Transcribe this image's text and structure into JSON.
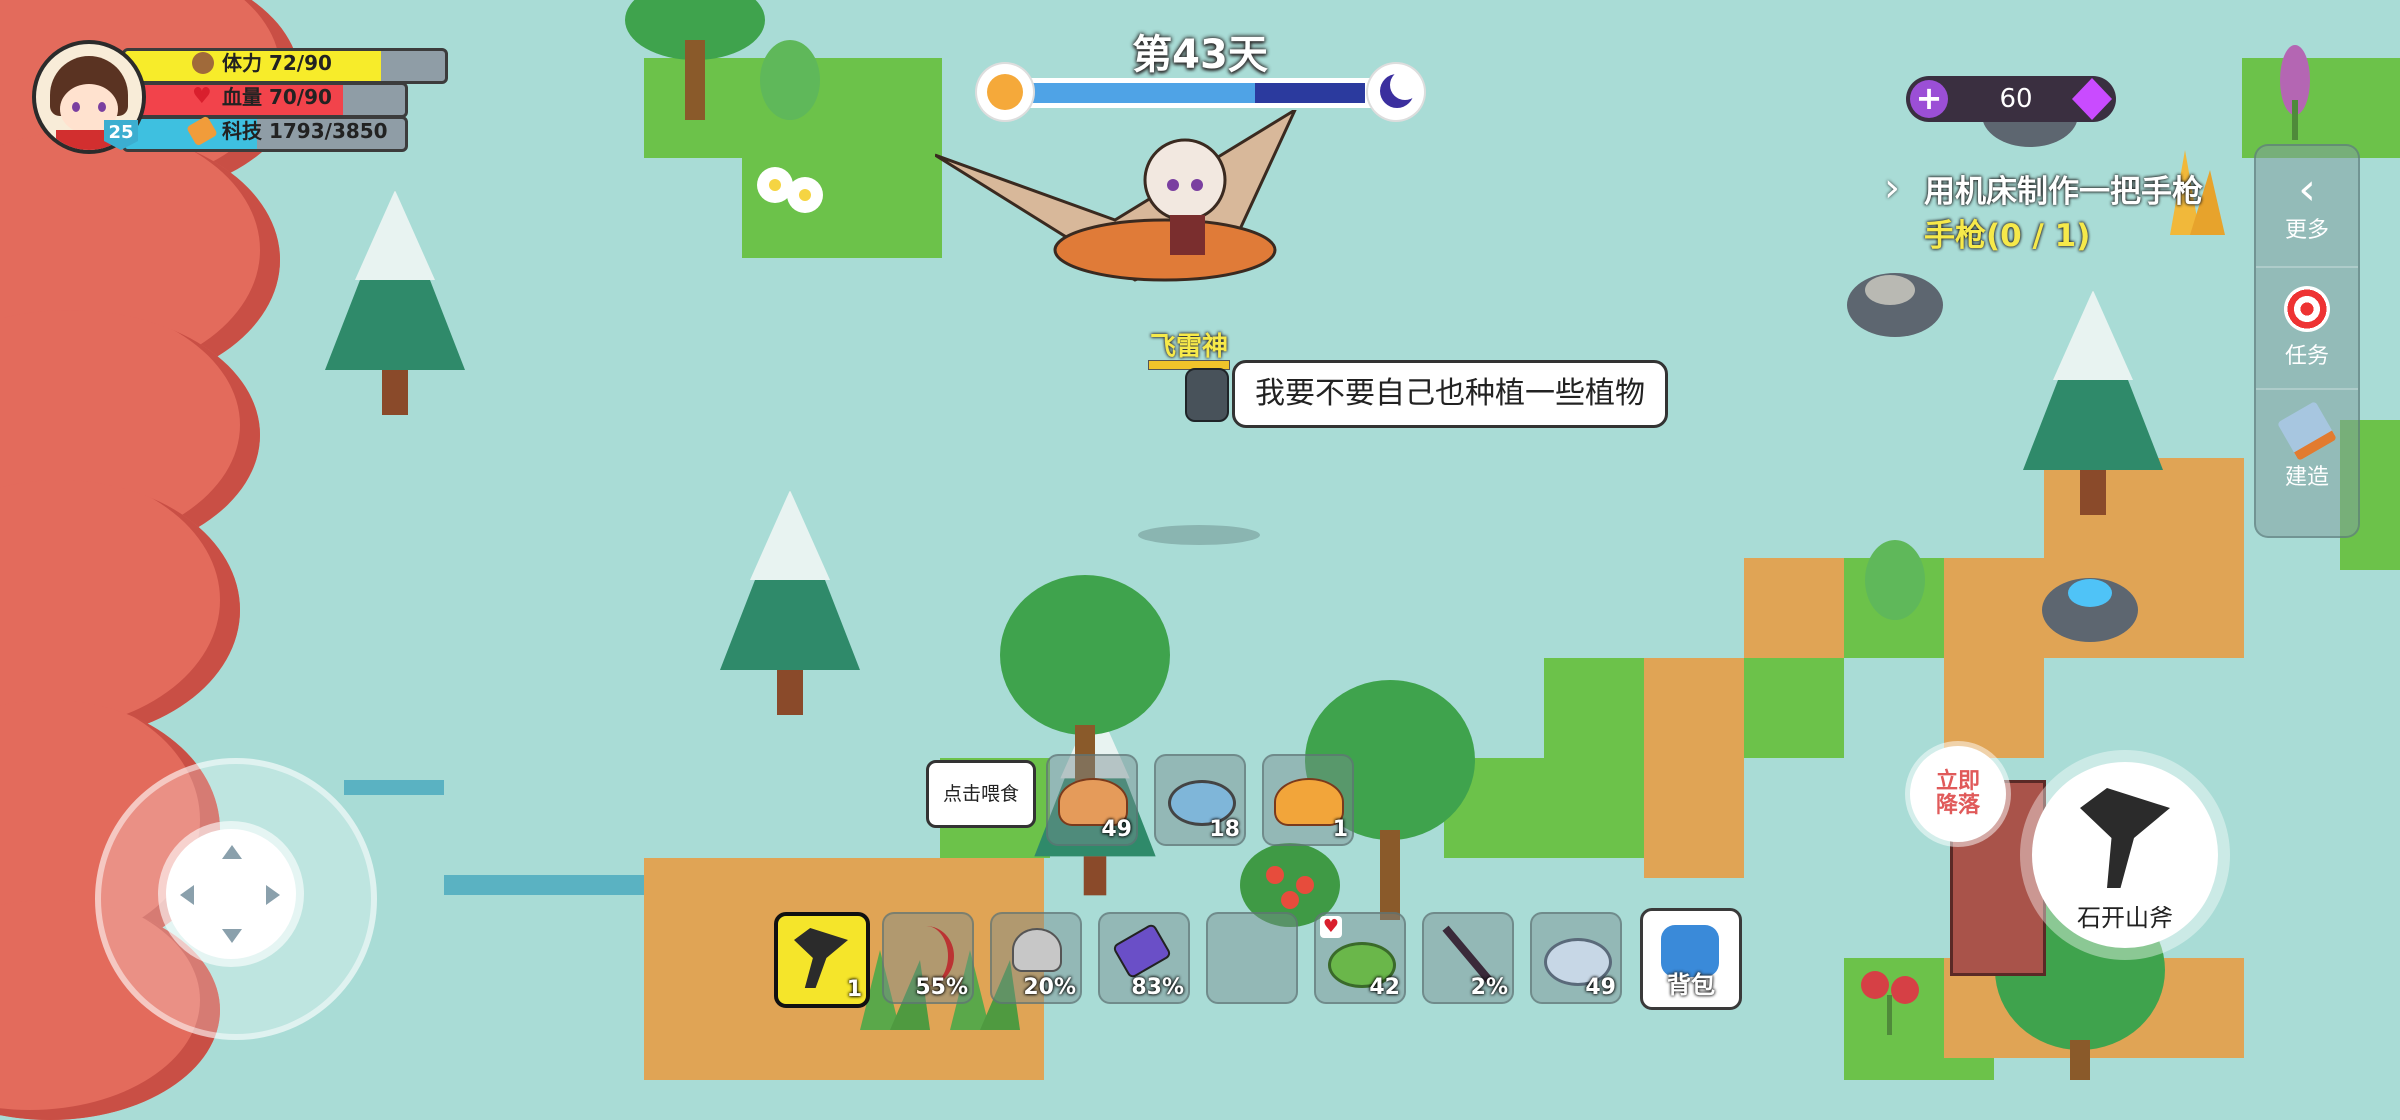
{
  "hud": {
    "level": "25",
    "stamina": {
      "label": "体力",
      "value": "72/90",
      "fraction": 0.8
    },
    "health": {
      "label": "血量",
      "value": "70/90",
      "fraction": 0.78
    },
    "tech": {
      "label": "科技",
      "value": "1793/3850",
      "fraction": 0.47
    }
  },
  "day": {
    "label": "第43天",
    "progress": 0.68
  },
  "gems": {
    "value": "60"
  },
  "quest": {
    "title": "用机床制作一把手枪",
    "progress": "手枪(0 / 1)"
  },
  "sidebar": [
    {
      "label": "更多",
      "icon": "chevron-left-icon"
    },
    {
      "label": "任务",
      "icon": "target-icon"
    },
    {
      "label": "建造",
      "icon": "hammer-icon"
    }
  ],
  "npc": {
    "name": "飞雷神",
    "speech": "我要不要自己也种植一些植物"
  },
  "feed": {
    "label": "点击喂食",
    "items": [
      {
        "icon": "roast-meat-icon",
        "count": "49"
      },
      {
        "icon": "canned-food-icon",
        "count": "18"
      },
      {
        "icon": "fruit-tart-icon",
        "count": "1"
      }
    ]
  },
  "hotbar": [
    {
      "icon": "stone-axe-icon",
      "count": "1",
      "selected": true
    },
    {
      "icon": "bow-icon",
      "count": "55%"
    },
    {
      "icon": "battle-axe-icon",
      "count": "20%"
    },
    {
      "icon": "battery-icon",
      "count": "83%"
    },
    {
      "icon": "empty-slot-icon",
      "count": ""
    },
    {
      "icon": "herb-bowl-icon",
      "count": "42"
    },
    {
      "icon": "spear-icon",
      "count": "2%"
    },
    {
      "icon": "stew-bowl-icon",
      "count": "49"
    }
  ],
  "backpack": {
    "label": "背包"
  },
  "land_button": {
    "label": "立即\n降落",
    "line1": "立即",
    "line2": "降落"
  },
  "action": {
    "label": "石开山斧"
  },
  "colors": {
    "stamina": "#f7ec2a",
    "health": "#f2434b",
    "tech": "#3ec0e0",
    "day": "#4fa3e6",
    "night": "#2b3a9e"
  }
}
